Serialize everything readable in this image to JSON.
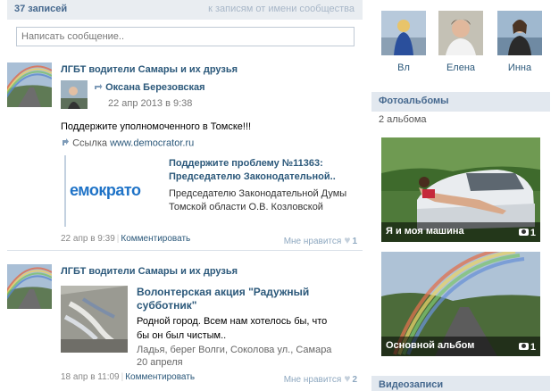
{
  "wall": {
    "count": "37 записей",
    "owner_link": "к записям от имени сообщества",
    "composer_placeholder": "Написать сообщение.."
  },
  "posts": [
    {
      "author": "ЛГБТ водители Самары и их друзья",
      "repost_name": "Оксана Березовская",
      "repost_date": "22 апр 2013 в 9:38",
      "text": "Поддержите уполномоченного в Томске!!!",
      "link_prefix": "Ссылка",
      "link_url": "www.democrator.ru",
      "preview_logo": "емократо",
      "preview_title": "Поддержите проблему №11363: Председателю Законодательной..",
      "preview_desc": "Председателю Законодательной Думы Томской области О.В. Козловской",
      "date": "22 апр в 9:39",
      "comment": "Комментировать",
      "like_label": "Мне нравится",
      "like_count": "1"
    },
    {
      "author": "ЛГБТ водители Самары и их друзья",
      "att_title": "Волонтерская акция \"Радужный субботник\"",
      "att_text": "Родной город. Всем нам хотелось бы, что бы он был чистым..",
      "att_location": "Ладья, берег Волги, Соколова ул., Самара",
      "att_date": "20 апреля",
      "date": "18 апр в 11:09",
      "comment": "Комментировать",
      "like_label": "Мне нравится",
      "like_count": "2"
    }
  ],
  "friends": [
    {
      "name": "Вл"
    },
    {
      "name": "Елена"
    },
    {
      "name": "Инна"
    }
  ],
  "albums": {
    "header": "Фотоальбомы",
    "count": "2 альбома",
    "items": [
      {
        "title": "Я и моя машина",
        "count": "1"
      },
      {
        "title": "Основной альбом",
        "count": "1"
      }
    ]
  },
  "videos": {
    "header": "Видеозаписи"
  },
  "icons": {
    "repost": "repost-arrow-icon",
    "link": "link-arrow-icon",
    "heart": "heart-icon",
    "camera": "camera-icon"
  }
}
